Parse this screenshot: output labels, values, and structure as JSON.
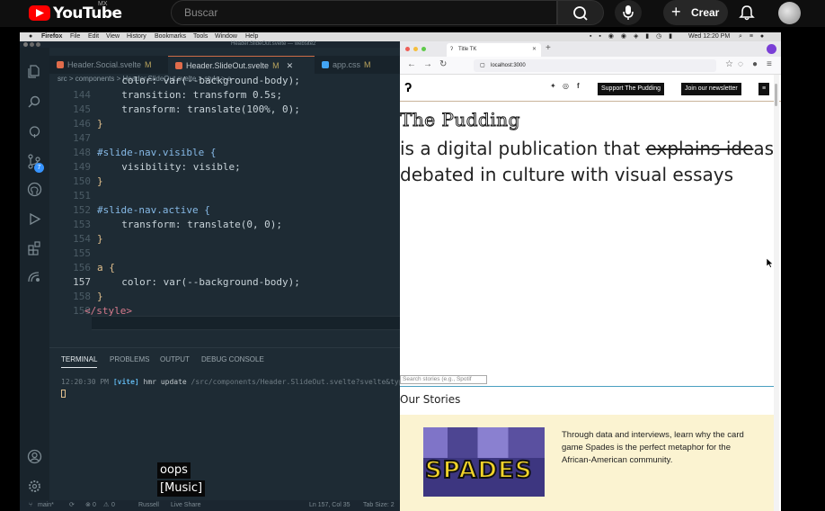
{
  "youtube": {
    "brand": "YouTube",
    "country": "MX",
    "search_placeholder": "Buscar",
    "create_label": "Crear"
  },
  "mac": {
    "apple": "",
    "menus": [
      "Firefox",
      "File",
      "Edit",
      "View",
      "History",
      "Bookmarks",
      "Tools",
      "Window",
      "Help"
    ],
    "clock": "Wed 12:20 PM"
  },
  "vscode": {
    "window_title": "Header.SlideOut.svelte — website2",
    "tabs": [
      {
        "label": "Header.Social.svelte",
        "mod": "M"
      },
      {
        "label": "Header.SlideOut.svelte",
        "mod": "M"
      },
      {
        "label": "app.css",
        "mod": "M"
      }
    ],
    "breadcrumb": "src > components > Header.SlideOut.svelte > style > a",
    "source_control_badge": "7",
    "line_numbers": [
      "144",
      "145",
      "146",
      "147",
      "148",
      "149",
      "150",
      "151",
      "152",
      "153",
      "154",
      "155",
      "156",
      "157",
      "158",
      "159"
    ],
    "code_lines": [
      "  color: var(--background-body);",
      "  transition: transform 0.5s;",
      "  transform: translate(100%, 0);",
      "}",
      "",
      "#slide-nav.visible {",
      "  visibility: visible;",
      "}",
      "",
      "#slide-nav.active {",
      "  transform: translate(0, 0);",
      "}",
      "",
      "a {",
      "  color: var(--background-body);",
      "}",
      "</style>"
    ],
    "panel_tabs": [
      "TERMINAL",
      "PROBLEMS",
      "OUTPUT",
      "DEBUG CONSOLE"
    ],
    "terminal": {
      "time": "12:20:30 PM",
      "tool": "[vite]",
      "msg": "hmr update",
      "path": "/src/components/Header.SlideOut.svelte?svelte&type"
    },
    "status": {
      "branch": "main*",
      "errors": "0",
      "warnings": "0",
      "user": "Russell",
      "live": "Live Share",
      "position": "Ln 157, Col 35",
      "tab_size": "Tab Size: 2"
    }
  },
  "captions": [
    "oops",
    "[Music]"
  ],
  "browser": {
    "tab_title": "Title TK",
    "url": "localhost:3000",
    "buttons": {
      "support": "Support The Pudding",
      "newsletter": "Join our newsletter"
    },
    "hero_title": "The Pudding",
    "hero_sub_1": "is a digital publication that ",
    "hero_strike": "explains ide",
    "hero_sub_2": "as debated in culture with visual essays",
    "search_placeholder": "Search stories (e.g., Spotif",
    "stories_heading": "Our Stories",
    "card_text": "Through data and interviews, learn why the card game Spades is the perfect metaphor for the African-American community.",
    "card_image_text": "SPADES"
  }
}
